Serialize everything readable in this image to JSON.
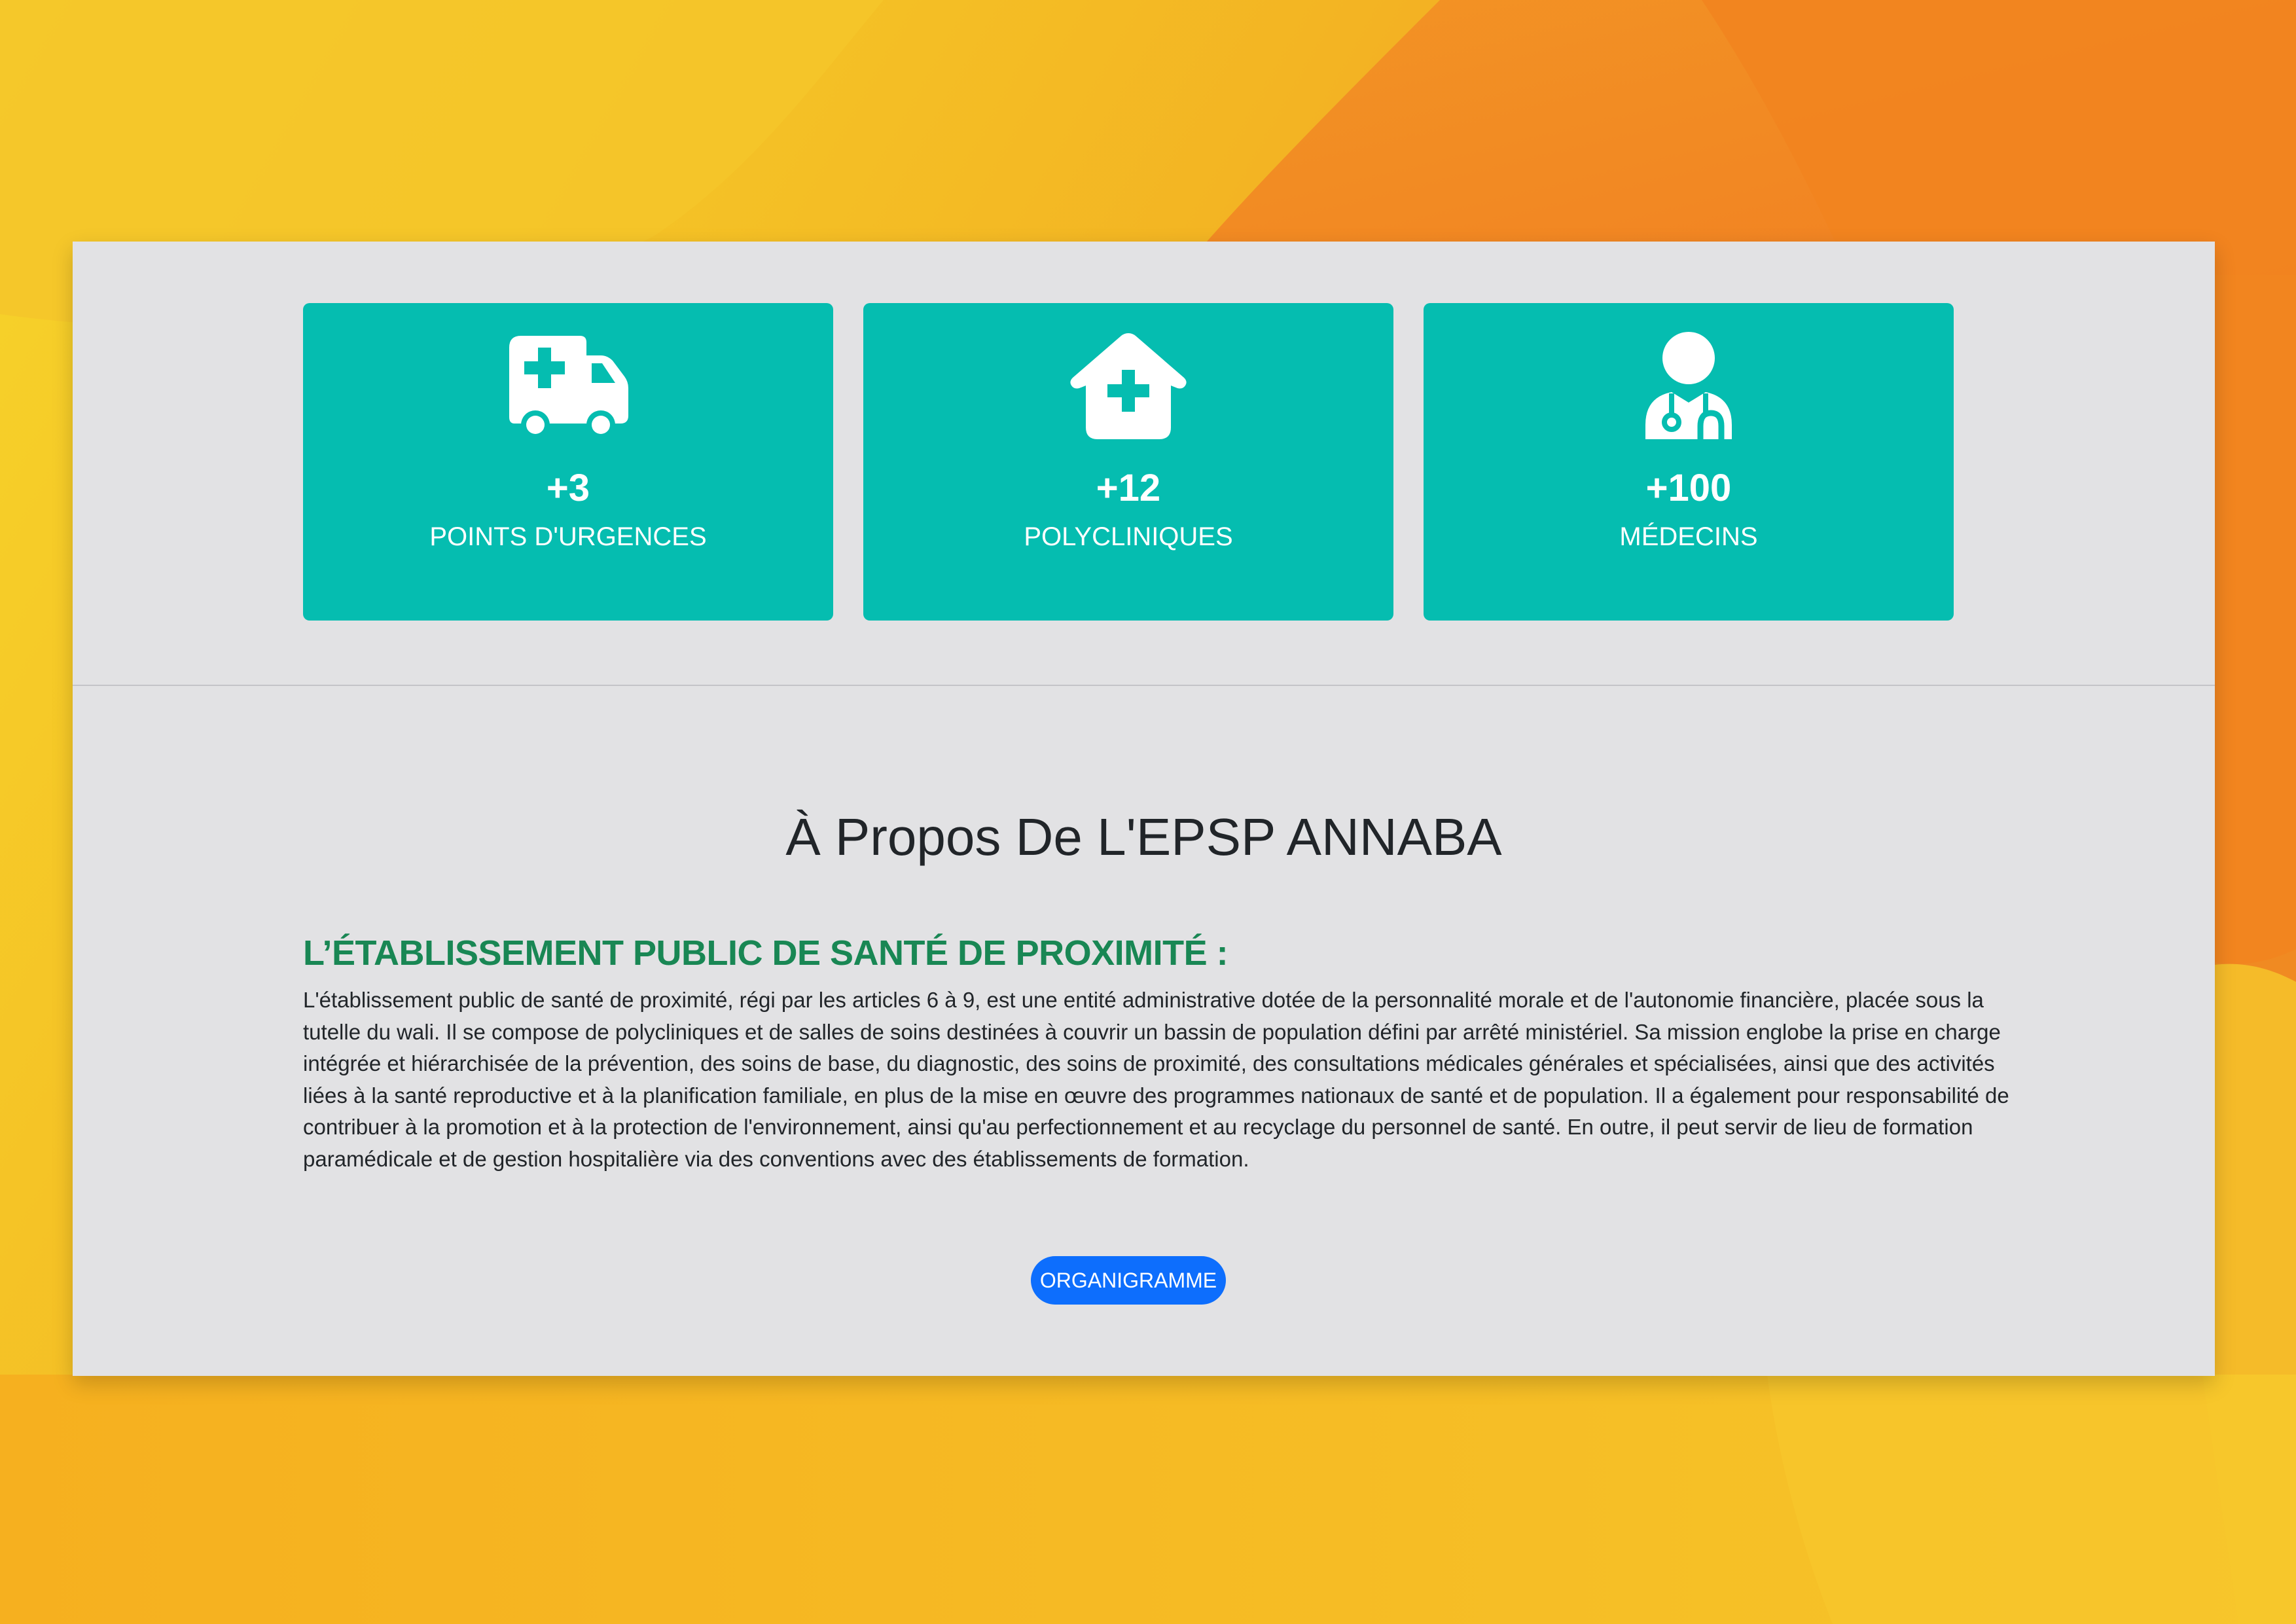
{
  "stats": [
    {
      "icon": "ambulance-icon",
      "count": "+3",
      "label": "POINTS D'URGENCES"
    },
    {
      "icon": "clinic-house-icon",
      "count": "+12",
      "label": "POLYCLINIQUES"
    },
    {
      "icon": "doctor-icon",
      "count": "+100",
      "label": "MÉDECINS"
    }
  ],
  "about": {
    "title": "À Propos De L'EPSP ANNABA",
    "subtitle": "L’ÉTABLISSEMENT PUBLIC DE SANTÉ DE PROXIMITÉ :",
    "paragraph": "L'établissement public de santé de proximité, régi par les articles 6 à 9, est une entité administrative dotée de la personnalité morale et de l'autonomie financière, placée sous la tutelle du wali. Il se compose de polycliniques et de salles de soins destinées à couvrir un bassin de population défini par arrêté ministériel. Sa mission englobe la prise en charge intégrée et hiérarchisée de la prévention, des soins de base, du diagnostic, des soins de proximité, des consultations médicales générales et spécialisées, ainsi que des activités liées à la santé reproductive et à la planification familiale, en plus de la mise en œuvre des programmes nationaux de santé et de population. Il a également pour responsabilité de contribuer à la promotion et à la protection de l'environnement, ainsi qu'au perfectionnement et au recyclage du personnel de santé. En outre, il peut servir de lieu de formation paramédicale et de gestion hospitalière via des conventions avec des établissements de formation.",
    "button_label": "ORGANIGRAMME"
  },
  "colors": {
    "card_bg": "#05bdb0",
    "subtitle": "#198754",
    "button": "#0d6efd",
    "panel_bg": "#e2e2e4"
  }
}
